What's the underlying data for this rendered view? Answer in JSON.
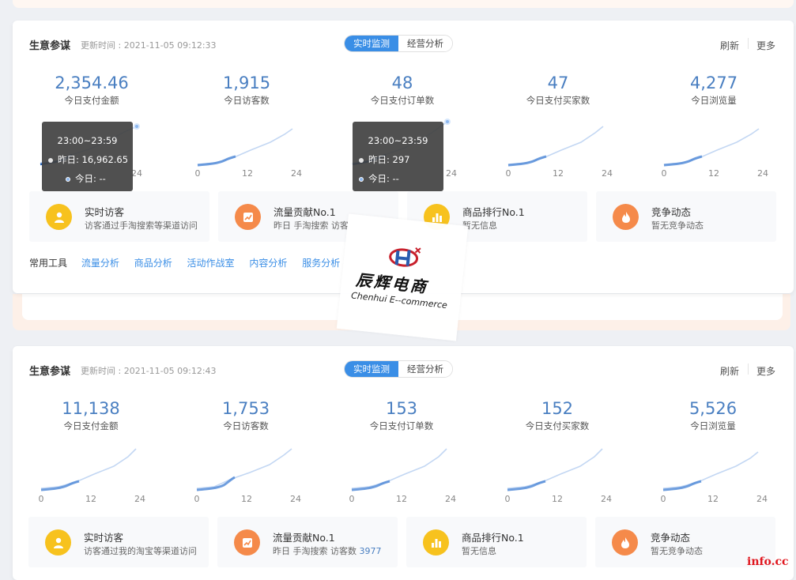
{
  "panel1": {
    "title": "生意参谋",
    "updated": "更新时间 : 2021-11-05 09:12:33",
    "tab_realtime": "实时监测",
    "tab_analysis": "经营分析",
    "refresh": "刷新",
    "more": "更多",
    "metrics": [
      {
        "value": "2,354.46",
        "label": "今日支付金额"
      },
      {
        "value": "1,915",
        "label": "今日访客数"
      },
      {
        "value": "48",
        "label": "今日支付订单数"
      },
      {
        "value": "47",
        "label": "今日支付买家数"
      },
      {
        "value": "4,277",
        "label": "今日浏览量"
      }
    ],
    "axis": [
      "0",
      "12",
      "24"
    ],
    "tooltips": [
      {
        "title": "23:00~23:59",
        "yesterday": "昨日: 16,962.65",
        "today": "今日: --"
      },
      {
        "title": "23:00~23:59",
        "yesterday": "昨日: 297",
        "today": "今日: --"
      }
    ],
    "cards": [
      {
        "title": "实时访客",
        "desc": "访客通过手淘搜索等渠道访问",
        "num": "",
        "color": "#f7c21e",
        "icon": "user-icon"
      },
      {
        "title": "流量贡献No.1",
        "desc": "昨日 手淘搜索 访客",
        "num": "",
        "color": "#f58a4a",
        "icon": "trend-icon"
      },
      {
        "title": "商品排行No.1",
        "desc": "暂无信息",
        "num": "",
        "color": "#f7c21e",
        "icon": "bar-chart-icon"
      },
      {
        "title": "竞争动态",
        "desc": "暂无竞争动态",
        "num": "",
        "color": "#f58a4a",
        "icon": "flame-icon"
      }
    ],
    "tools_label": "常用工具",
    "tools": [
      "流量分析",
      "商品分析",
      "活动作战室",
      "内容分析",
      "服务分析"
    ]
  },
  "panel2": {
    "title": "生意参谋",
    "updated": "更新时间 : 2021-11-05 09:12:43",
    "tab_realtime": "实时监测",
    "tab_analysis": "经营分析",
    "refresh": "刷新",
    "more": "更多",
    "metrics": [
      {
        "value": "11,138",
        "label": "今日支付金额"
      },
      {
        "value": "1,753",
        "label": "今日访客数"
      },
      {
        "value": "153",
        "label": "今日支付订单数"
      },
      {
        "value": "152",
        "label": "今日支付买家数"
      },
      {
        "value": "5,526",
        "label": "今日浏览量"
      }
    ],
    "axis": [
      "0",
      "12",
      "24"
    ],
    "cards": [
      {
        "title": "实时访客",
        "desc": "访客通过我的淘宝等渠道访问",
        "num": "",
        "color": "#f7c21e",
        "icon": "user-icon"
      },
      {
        "title": "流量贡献No.1",
        "desc": "昨日 手淘搜索 访客数 ",
        "num": "3977",
        "color": "#f58a4a",
        "icon": "trend-icon"
      },
      {
        "title": "商品排行No.1",
        "desc": "暂无信息",
        "num": "",
        "color": "#f7c21e",
        "icon": "bar-chart-icon"
      },
      {
        "title": "竞争动态",
        "desc": "暂无竞争动态",
        "num": "",
        "color": "#f58a4a",
        "icon": "flame-icon"
      }
    ]
  },
  "watermark": {
    "cn": "辰辉电商",
    "en": "Chenhui E--commerce"
  },
  "footer_mark": "info.cc"
}
